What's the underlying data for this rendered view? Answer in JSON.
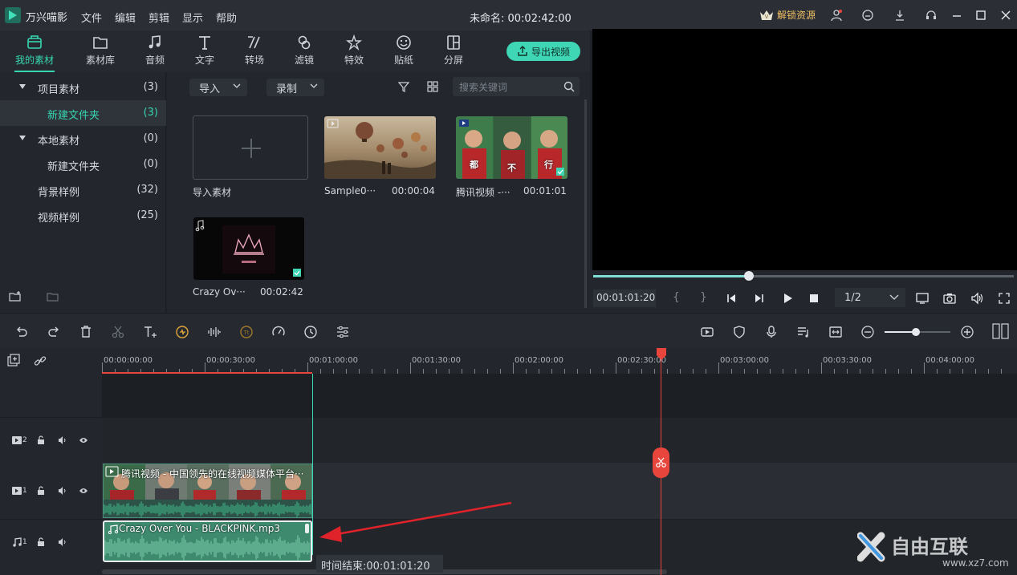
{
  "titlebar": {
    "app_name": "万兴喵影",
    "menus": [
      "文件",
      "编辑",
      "剪辑",
      "显示",
      "帮助"
    ],
    "project_title": "未命名: 00:02:42:00",
    "unlock_label": "解锁资源"
  },
  "media_tabs": [
    {
      "label": "我的素材",
      "icon": "folder-box-icon",
      "active": true
    },
    {
      "label": "素材库",
      "icon": "folder-icon"
    },
    {
      "label": "音频",
      "icon": "music-note-icon"
    },
    {
      "label": "文字",
      "icon": "text-t-icon"
    },
    {
      "label": "转场",
      "icon": "transition-icon"
    },
    {
      "label": "滤镜",
      "icon": "filter-icon"
    },
    {
      "label": "特效",
      "icon": "effects-star-icon"
    },
    {
      "label": "贴纸",
      "icon": "sticker-smile-icon"
    },
    {
      "label": "分屏",
      "icon": "split-screen-icon"
    }
  ],
  "export_label": "导出视频",
  "library_tree": [
    {
      "label": "项目素材",
      "count": "(3)",
      "expanded": true
    },
    {
      "label": "新建文件夹",
      "count": "(3)",
      "selected": true
    },
    {
      "label": "本地素材",
      "count": "(0)",
      "expanded": true
    },
    {
      "label": "新建文件夹",
      "count": "(0)"
    },
    {
      "label": "背景样例",
      "count": "(32)"
    },
    {
      "label": "视频样例",
      "count": "(25)"
    }
  ],
  "library_toolbar": {
    "import_label": "导入",
    "record_label": "录制",
    "search_placeholder": "搜索关键词"
  },
  "media_items": [
    {
      "name": "导入素材",
      "duration": ""
    },
    {
      "name": "Sample0···",
      "duration": "00:00:04"
    },
    {
      "name": "腾讯视频 -···",
      "duration": "00:01:01",
      "overlay": [
        "都",
        "不",
        "行"
      ]
    },
    {
      "name": "Crazy Ov···",
      "duration": "00:02:42"
    }
  ],
  "player": {
    "current_time": "00:01:01:20",
    "quality": "1/2",
    "progress": 0.37
  },
  "timeline": {
    "ticks": [
      "00:00:00:00",
      "00:00:30:00",
      "00:01:00:00",
      "00:01:30:00",
      "00:02:00:00",
      "00:02:30:00",
      "00:03:00:00",
      "00:03:30:00",
      "00:04:00:00"
    ],
    "tracks": [
      {
        "id": "2",
        "kind": "video"
      },
      {
        "id": "1",
        "kind": "video"
      },
      {
        "id": "1",
        "kind": "audio"
      }
    ],
    "video_clip_label": "腾讯视频 - 中国领先的在线视频媒体平台···",
    "audio_clip_label": "Crazy Over You - BLACKPINK.mp3",
    "end_time_label": "时间结束:00:01:01:20"
  },
  "colors": {
    "accent": "#36d6b0",
    "playhead": "#e8453c",
    "annotation_arrow": "#e0222a"
  }
}
